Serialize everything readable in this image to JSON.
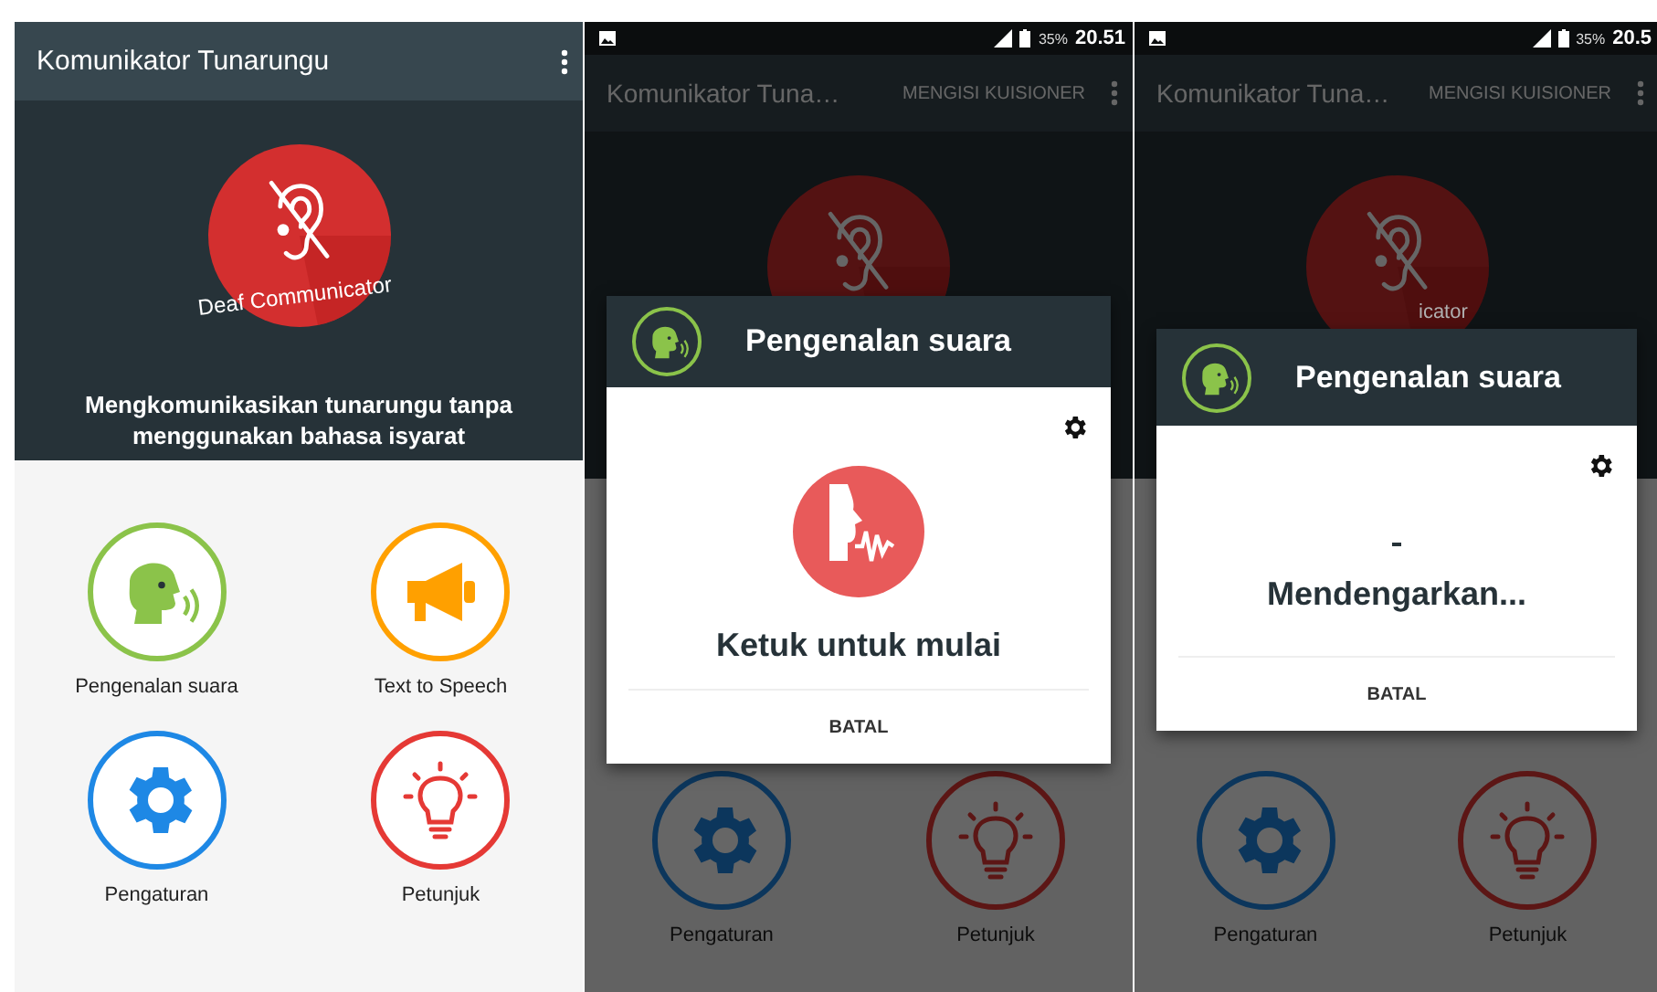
{
  "screens": [
    {
      "kind": "home",
      "app_bar": {
        "title": "Komunikator Tunarungu"
      },
      "logo_caption": "Deaf Communicator",
      "tagline": "Mengkomunikasikan tunarungu tanpa menggunakan bahasa isyarat",
      "menu_items": [
        {
          "label": "Pengenalan suara",
          "kind": "voice"
        },
        {
          "label": "Text to Speech",
          "kind": "speaker"
        },
        {
          "label": "Pengaturan",
          "kind": "settings"
        },
        {
          "label": "Petunjuk",
          "kind": "hint"
        }
      ]
    },
    {
      "kind": "dialog",
      "status_bar": {
        "battery": "35%",
        "time": "20.51"
      },
      "app_bar": {
        "title": "Komunikator Tuna…",
        "action": "MENGISI KUISIONER"
      },
      "menu_items": [
        {
          "label": "Pengaturan",
          "kind": "settings"
        },
        {
          "label": "Petunjuk",
          "kind": "hint"
        }
      ],
      "dialog": {
        "title": "Pengenalan suara",
        "kind": "idle",
        "message": "Ketuk untuk mulai",
        "cancel": "BATAL"
      }
    },
    {
      "kind": "dialog",
      "status_bar": {
        "battery": "35%",
        "time": "20.5"
      },
      "app_bar": {
        "title": "Komunikator Tuna…",
        "action": "MENGISI KUISIONER"
      },
      "logo_caption": "icator",
      "menu_items": [
        {
          "label": "Pengaturan",
          "kind": "settings"
        },
        {
          "label": "Petunjuk",
          "kind": "hint"
        }
      ],
      "dialog": {
        "title": "Pengenalan suara",
        "kind": "listening",
        "message": "Mendengarkan...",
        "cancel": "BATAL"
      }
    }
  ]
}
